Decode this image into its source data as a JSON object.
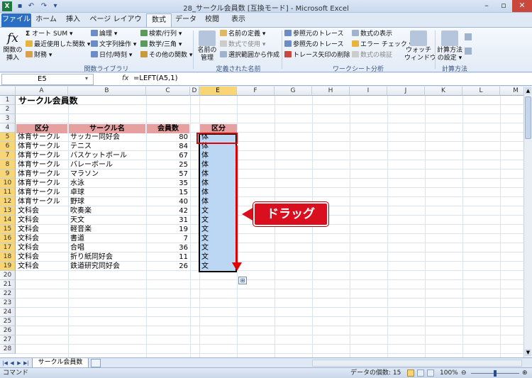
{
  "window": {
    "title": "28_サークル会員数 [互換モード] - Microsoft Excel"
  },
  "tabs": [
    "ファイル",
    "ホーム",
    "挿入",
    "ページ レイアウト",
    "数式",
    "データ",
    "校閲",
    "表示"
  ],
  "ribbon": {
    "insert_function": "関数の\n挿入",
    "autosum": "オート SUM ▾",
    "recent": "最近使用した関数 ▾",
    "financial": "財務 ▾",
    "logical": "論理 ▾",
    "text": "文字列操作 ▾",
    "datetime": "日付/時刻 ▾",
    "lookup": "検索/行列 ▾",
    "math": "数学/三角 ▾",
    "more": "その他の関数 ▾",
    "group_library": "関数ライブラリ",
    "name_manager": "名前の\n管理",
    "define_name": "名前の定義 ▾",
    "use_in_formula": "数式で使用 ▾",
    "create_from_sel": "選択範囲から作成",
    "group_names": "定義された名前",
    "trace_prec": "参照元のトレース",
    "trace_dep": "参照先のトレース",
    "remove_arrows": "トレース矢印の削除 ▾",
    "show_formulas": "数式の表示",
    "error_check": "エラー チェック ▾",
    "evaluate": "数式の検証",
    "watch": "ウォッチ\nウィンドウ",
    "group_audit": "ワークシート分析",
    "calc_options": "計算方法\nの設定 ▾",
    "group_calc": "計算方法"
  },
  "formula_bar": {
    "name_box": "E5",
    "fx": "fx",
    "formula": "=LEFT(A5,1)"
  },
  "columns": [
    "A",
    "B",
    "C",
    "D",
    "E",
    "F",
    "G",
    "H",
    "I",
    "J",
    "K",
    "L",
    "M"
  ],
  "rows": [
    "1",
    "2",
    "3",
    "4",
    "5",
    "6",
    "7",
    "8",
    "9",
    "10",
    "11",
    "12",
    "13",
    "14",
    "15",
    "16",
    "17",
    "18",
    "19",
    "20",
    "21",
    "22",
    "23",
    "24",
    "25",
    "26",
    "27",
    "28"
  ],
  "sheet": {
    "title": "サークル会員数",
    "headers": {
      "a": "区分",
      "b": "サークル名",
      "c": "会員数",
      "e": "区分"
    },
    "data": [
      [
        "体育サークル",
        "サッカー同好会",
        "80",
        "体"
      ],
      [
        "体育サークル",
        "テニス",
        "84",
        "体"
      ],
      [
        "体育サークル",
        "バスケットボール",
        "67",
        "体"
      ],
      [
        "体育サークル",
        "バレーボール",
        "25",
        "体"
      ],
      [
        "体育サークル",
        "マラソン",
        "57",
        "体"
      ],
      [
        "体育サークル",
        "水泳",
        "35",
        "体"
      ],
      [
        "体育サークル",
        "卓球",
        "15",
        "体"
      ],
      [
        "体育サークル",
        "野球",
        "40",
        "体"
      ],
      [
        "文科会",
        "吹奏楽",
        "42",
        "文"
      ],
      [
        "文科会",
        "天文",
        "31",
        "文"
      ],
      [
        "文科会",
        "軽音楽",
        "19",
        "文"
      ],
      [
        "文科会",
        "書道",
        "7",
        "文"
      ],
      [
        "文科会",
        "合唱",
        "36",
        "文"
      ],
      [
        "文科会",
        "折り紙同好会",
        "11",
        "文"
      ],
      [
        "文科会",
        "鉄道研究同好会",
        "26",
        "文"
      ]
    ]
  },
  "callout": "ドラッグ",
  "sheet_tab": "サークル会員数",
  "status": {
    "mode": "コマンド",
    "count": "データの個数: 15",
    "zoom": "100%"
  }
}
